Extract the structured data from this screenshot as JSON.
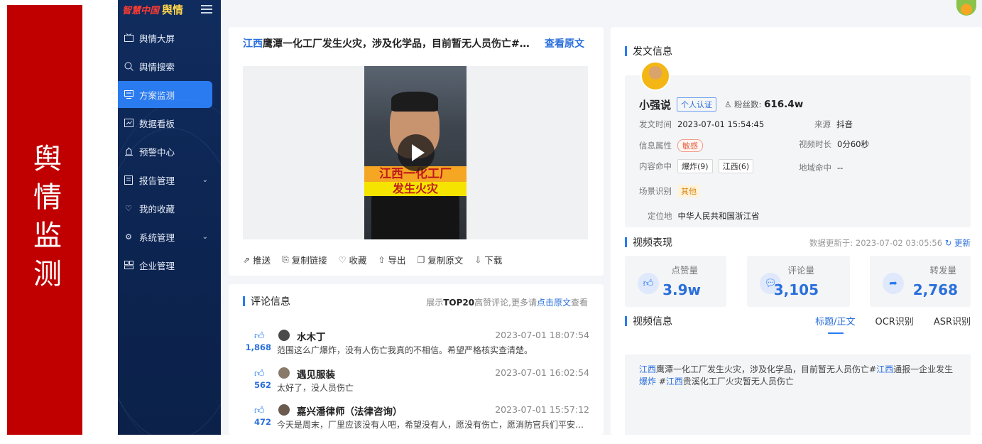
{
  "banner": {
    "text": "舆情监测"
  },
  "sidebar": {
    "logo_mark": "智慧中国",
    "logo_text": "舆情",
    "items": [
      {
        "label": "舆情大屏",
        "icon": "monitor-icon"
      },
      {
        "label": "舆情搜索",
        "icon": "search-icon"
      },
      {
        "label": "方案监测",
        "icon": "scheme-icon",
        "active": true
      },
      {
        "label": "数据看板",
        "icon": "dashboard-icon"
      },
      {
        "label": "预警中心",
        "icon": "alarm-icon"
      },
      {
        "label": "报告管理",
        "icon": "report-icon",
        "expandable": true
      },
      {
        "label": "我的收藏",
        "icon": "heart-icon"
      },
      {
        "label": "系统管理",
        "icon": "gear-icon",
        "expandable": true
      },
      {
        "label": "企业管理",
        "icon": "org-icon"
      }
    ]
  },
  "video": {
    "title_keyword": "江西",
    "title_rest": "鹰潭一化工厂发生火灾，涉及化学品，目前暂无人员伤亡#江西通报一企业发生爆炸",
    "view_original": "查看原文",
    "caption_line1": "江西一化工厂",
    "caption_line2": "发生火灾",
    "actions": [
      {
        "label": "推送",
        "icon": "share-icon"
      },
      {
        "label": "复制链接",
        "icon": "link-icon"
      },
      {
        "label": "收藏",
        "icon": "heart-icon"
      },
      {
        "label": "导出",
        "icon": "export-icon"
      },
      {
        "label": "复制原文",
        "icon": "copy-icon"
      },
      {
        "label": "下载",
        "icon": "download-icon"
      }
    ]
  },
  "comments": {
    "title": "评论信息",
    "hint_prefix": "展示",
    "hint_bold": "TOP20",
    "hint_mid": "高赞评论,更多请",
    "hint_link": "点击原文",
    "hint_suffix": "查看",
    "list": [
      {
        "likes": "1,868",
        "name": "水木丁",
        "time": "2023-07-01 18:07:54",
        "text": "范围这么广爆炸，没有人伤亡我真的不相信。希望严格核实查清楚。"
      },
      {
        "likes": "562",
        "name": "遇见服装",
        "time": "2023-07-01 16:02:54",
        "text": "太好了，没人员伤亡"
      },
      {
        "likes": "472",
        "name": "嘉兴潘律师（法律咨询）",
        "time": "2023-07-01 15:57:12",
        "text": "今天是周末，厂里应该没有人吧，希望没有人，愿没有伤亡，愿消防官兵们平安归来"
      }
    ]
  },
  "post_info": {
    "title": "发文信息",
    "author": "小强说",
    "verified": "个人认证",
    "fans_label": "粉丝数:",
    "fans_value": "616.4w",
    "publish_time_label": "发文时间",
    "publish_time": "2023-07-01 15:54:45",
    "source_label": "来源",
    "source": "抖音",
    "attr_label": "信息属性",
    "attr_value": "敏感",
    "duration_label": "视频时长",
    "duration": "0分60秒",
    "content_hit_label": "内容命中",
    "content_hits": [
      "爆炸(9)",
      "江西(6)"
    ],
    "region_hit_label": "地域命中",
    "region_hit": "--",
    "scene_label": "场景识别",
    "scene_value": "其他",
    "location_label": "定位地",
    "location": "中华人民共和国浙江省"
  },
  "performance": {
    "title": "视频表现",
    "update_prefix": "数据更新于:",
    "update_time": "2023-07-02 03:05:56",
    "refresh": "更新",
    "likes_label": "点赞量",
    "likes": "3.9w",
    "comments_label": "评论量",
    "comments": "3,105",
    "shares_label": "转发量",
    "shares": "2,768"
  },
  "video_info": {
    "title": "视频信息",
    "tabs": [
      "标题/正文",
      "OCR识别",
      "ASR识别"
    ],
    "text_parts": [
      {
        "t": "江西",
        "hl": true
      },
      {
        "t": "鹰潭一化工厂发生火灾，涉及化学品，目前暂无人员伤亡#",
        "hl": false
      },
      {
        "t": "江西",
        "hl": true
      },
      {
        "t": "通报一企业发生",
        "hl": false
      },
      {
        "t": "爆炸",
        "hl": true
      },
      {
        "t": " #",
        "hl": false
      },
      {
        "t": "江西",
        "hl": true
      },
      {
        "t": "贵溪化工厂火灾暂无人员伤亡",
        "hl": false
      }
    ]
  }
}
